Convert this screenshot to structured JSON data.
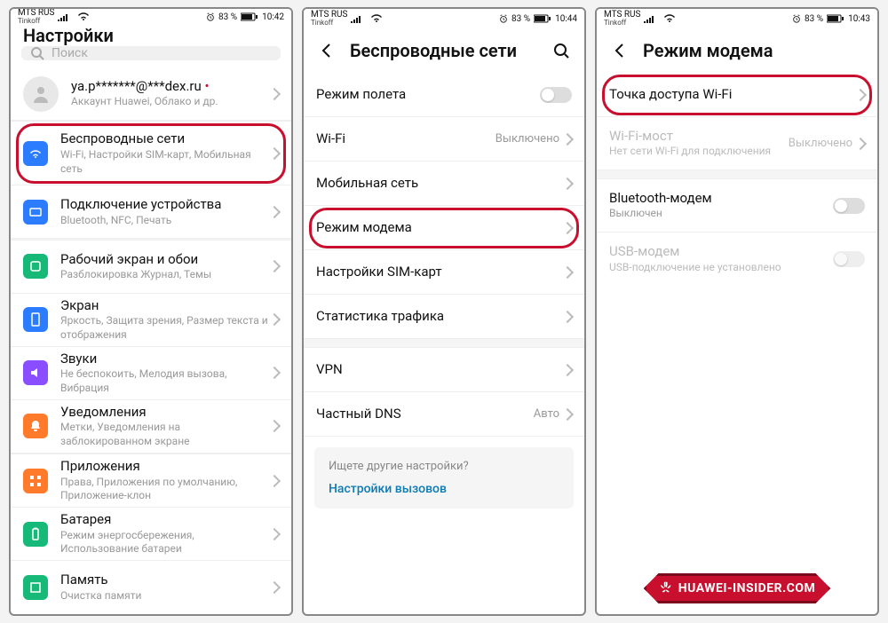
{
  "status": {
    "carrier": "MTS RUS",
    "carrier_sub": "Tinkoff",
    "battery": "83 %"
  },
  "times": [
    "10:42",
    "10:44",
    "10:43"
  ],
  "screen1": {
    "title": "Настройки",
    "search_placeholder": "Поиск",
    "account_name": "ya.p*******@***dex.ru",
    "account_sub": "Аккаунт Huawei, Облако и др.",
    "items": [
      {
        "t": "Беспроводные сети",
        "s": "Wi-Fi, Настройки SIM-карт, Мобильная сеть",
        "c": "#2b7cff"
      },
      {
        "t": "Подключение устройства",
        "s": "Bluetooth, NFC, Печать",
        "c": "#2b7cff"
      },
      {
        "t": "Рабочий экран и обои",
        "s": "Разблокировка Журнал, Темы",
        "c": "#17b978"
      },
      {
        "t": "Экран",
        "s": "Яркость, Защита зрения, Размер текста и отображения",
        "c": "#2b7cff"
      },
      {
        "t": "Звуки",
        "s": "Не беспокоить, Мелодия вызова, Вибрация",
        "c": "#8a4dff"
      },
      {
        "t": "Уведомления",
        "s": "Метки, Уведомления на заблокированном экране",
        "c": "#ff7b2b"
      },
      {
        "t": "Приложения",
        "s": "Права, Приложения по умолчанию, Приложение-клон",
        "c": "#ff7b2b"
      },
      {
        "t": "Батарея",
        "s": "Режим энергосбережения, Использование батареи",
        "c": "#17b978"
      },
      {
        "t": "Память",
        "s": "Очистка памяти",
        "c": "#17b978"
      }
    ]
  },
  "screen2": {
    "title": "Беспроводные сети",
    "items": [
      {
        "t": "Режим полета",
        "kind": "toggle"
      },
      {
        "t": "Wi-Fi",
        "v": "Выключено",
        "kind": "chev"
      },
      {
        "t": "Мобильная сеть",
        "kind": "chev"
      },
      {
        "t": "Режим модема",
        "kind": "chev",
        "hl": true
      },
      {
        "t": "Настройки SIM-карт",
        "kind": "chev"
      },
      {
        "t": "Статистика трафика",
        "kind": "chev"
      },
      {
        "t": "VPN",
        "kind": "chev",
        "gap": true
      },
      {
        "t": "Частный DNS",
        "v": "Авто",
        "kind": "chev"
      }
    ],
    "other_q": "Ищете другие настройки?",
    "other_link": "Настройки вызовов"
  },
  "screen3": {
    "title": "Режим модема",
    "items": [
      {
        "t": "Точка доступа Wi-Fi",
        "kind": "chev",
        "hl": true
      },
      {
        "t": "Wi-Fi-мост",
        "s": "Нет сети Wi-Fi для подключения",
        "v": "Выключено",
        "kind": "chev",
        "disabled": true
      },
      {
        "t": "Bluetooth-модем",
        "s": "Выключен",
        "kind": "toggle",
        "gap": true
      },
      {
        "t": "USB-модем",
        "s": "USB-подключение не установлено",
        "kind": "toggle",
        "disabled": true
      }
    ]
  },
  "watermark": "HUAWEI-INSIDER.COM"
}
